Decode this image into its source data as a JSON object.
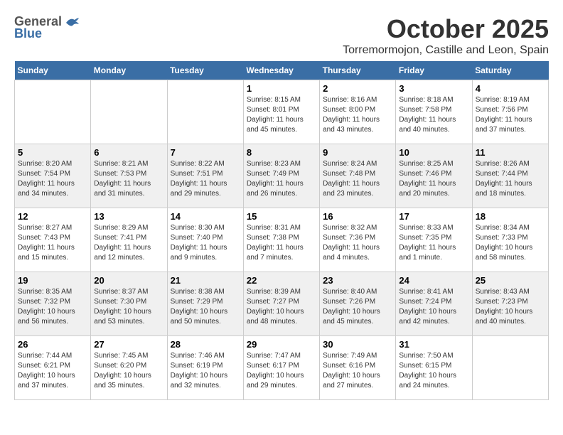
{
  "header": {
    "logo_general": "General",
    "logo_blue": "Blue",
    "month_title": "October 2025",
    "location": "Torremormojon, Castille and Leon, Spain"
  },
  "days_of_week": [
    "Sunday",
    "Monday",
    "Tuesday",
    "Wednesday",
    "Thursday",
    "Friday",
    "Saturday"
  ],
  "weeks": [
    [
      {
        "day": "",
        "info": ""
      },
      {
        "day": "",
        "info": ""
      },
      {
        "day": "",
        "info": ""
      },
      {
        "day": "1",
        "info": "Sunrise: 8:15 AM\nSunset: 8:01 PM\nDaylight: 11 hours and 45 minutes."
      },
      {
        "day": "2",
        "info": "Sunrise: 8:16 AM\nSunset: 8:00 PM\nDaylight: 11 hours and 43 minutes."
      },
      {
        "day": "3",
        "info": "Sunrise: 8:18 AM\nSunset: 7:58 PM\nDaylight: 11 hours and 40 minutes."
      },
      {
        "day": "4",
        "info": "Sunrise: 8:19 AM\nSunset: 7:56 PM\nDaylight: 11 hours and 37 minutes."
      }
    ],
    [
      {
        "day": "5",
        "info": "Sunrise: 8:20 AM\nSunset: 7:54 PM\nDaylight: 11 hours and 34 minutes."
      },
      {
        "day": "6",
        "info": "Sunrise: 8:21 AM\nSunset: 7:53 PM\nDaylight: 11 hours and 31 minutes."
      },
      {
        "day": "7",
        "info": "Sunrise: 8:22 AM\nSunset: 7:51 PM\nDaylight: 11 hours and 29 minutes."
      },
      {
        "day": "8",
        "info": "Sunrise: 8:23 AM\nSunset: 7:49 PM\nDaylight: 11 hours and 26 minutes."
      },
      {
        "day": "9",
        "info": "Sunrise: 8:24 AM\nSunset: 7:48 PM\nDaylight: 11 hours and 23 minutes."
      },
      {
        "day": "10",
        "info": "Sunrise: 8:25 AM\nSunset: 7:46 PM\nDaylight: 11 hours and 20 minutes."
      },
      {
        "day": "11",
        "info": "Sunrise: 8:26 AM\nSunset: 7:44 PM\nDaylight: 11 hours and 18 minutes."
      }
    ],
    [
      {
        "day": "12",
        "info": "Sunrise: 8:27 AM\nSunset: 7:43 PM\nDaylight: 11 hours and 15 minutes."
      },
      {
        "day": "13",
        "info": "Sunrise: 8:29 AM\nSunset: 7:41 PM\nDaylight: 11 hours and 12 minutes."
      },
      {
        "day": "14",
        "info": "Sunrise: 8:30 AM\nSunset: 7:40 PM\nDaylight: 11 hours and 9 minutes."
      },
      {
        "day": "15",
        "info": "Sunrise: 8:31 AM\nSunset: 7:38 PM\nDaylight: 11 hours and 7 minutes."
      },
      {
        "day": "16",
        "info": "Sunrise: 8:32 AM\nSunset: 7:36 PM\nDaylight: 11 hours and 4 minutes."
      },
      {
        "day": "17",
        "info": "Sunrise: 8:33 AM\nSunset: 7:35 PM\nDaylight: 11 hours and 1 minute."
      },
      {
        "day": "18",
        "info": "Sunrise: 8:34 AM\nSunset: 7:33 PM\nDaylight: 10 hours and 58 minutes."
      }
    ],
    [
      {
        "day": "19",
        "info": "Sunrise: 8:35 AM\nSunset: 7:32 PM\nDaylight: 10 hours and 56 minutes."
      },
      {
        "day": "20",
        "info": "Sunrise: 8:37 AM\nSunset: 7:30 PM\nDaylight: 10 hours and 53 minutes."
      },
      {
        "day": "21",
        "info": "Sunrise: 8:38 AM\nSunset: 7:29 PM\nDaylight: 10 hours and 50 minutes."
      },
      {
        "day": "22",
        "info": "Sunrise: 8:39 AM\nSunset: 7:27 PM\nDaylight: 10 hours and 48 minutes."
      },
      {
        "day": "23",
        "info": "Sunrise: 8:40 AM\nSunset: 7:26 PM\nDaylight: 10 hours and 45 minutes."
      },
      {
        "day": "24",
        "info": "Sunrise: 8:41 AM\nSunset: 7:24 PM\nDaylight: 10 hours and 42 minutes."
      },
      {
        "day": "25",
        "info": "Sunrise: 8:43 AM\nSunset: 7:23 PM\nDaylight: 10 hours and 40 minutes."
      }
    ],
    [
      {
        "day": "26",
        "info": "Sunrise: 7:44 AM\nSunset: 6:21 PM\nDaylight: 10 hours and 37 minutes."
      },
      {
        "day": "27",
        "info": "Sunrise: 7:45 AM\nSunset: 6:20 PM\nDaylight: 10 hours and 35 minutes."
      },
      {
        "day": "28",
        "info": "Sunrise: 7:46 AM\nSunset: 6:19 PM\nDaylight: 10 hours and 32 minutes."
      },
      {
        "day": "29",
        "info": "Sunrise: 7:47 AM\nSunset: 6:17 PM\nDaylight: 10 hours and 29 minutes."
      },
      {
        "day": "30",
        "info": "Sunrise: 7:49 AM\nSunset: 6:16 PM\nDaylight: 10 hours and 27 minutes."
      },
      {
        "day": "31",
        "info": "Sunrise: 7:50 AM\nSunset: 6:15 PM\nDaylight: 10 hours and 24 minutes."
      },
      {
        "day": "",
        "info": ""
      }
    ]
  ]
}
